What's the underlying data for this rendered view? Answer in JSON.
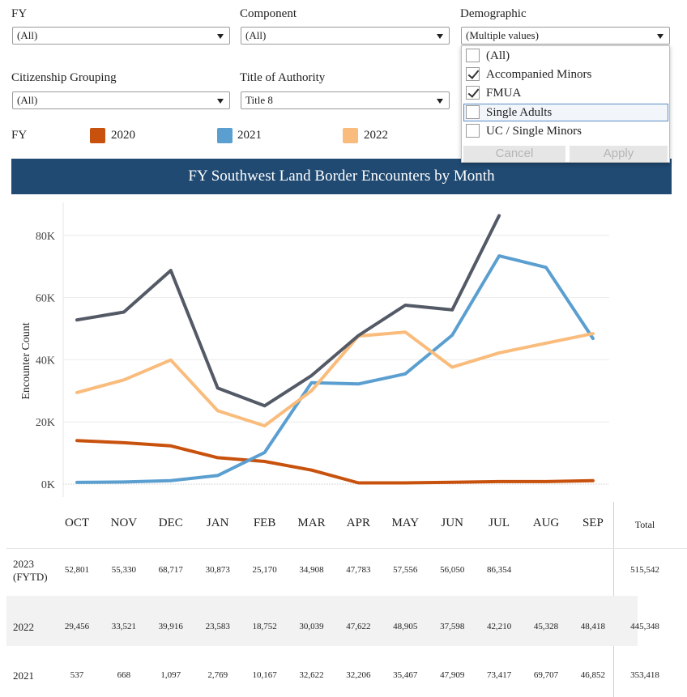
{
  "filters": {
    "fy": {
      "label": "FY",
      "value": "(All)"
    },
    "component": {
      "label": "Component",
      "value": "(All)"
    },
    "demographic": {
      "label": "Demographic",
      "value": "(Multiple values)"
    },
    "citizenship": {
      "label": "Citizenship Grouping",
      "value": "(All)"
    },
    "authority": {
      "label": "Title of Authority",
      "value": "Title 8"
    }
  },
  "demographic_dropdown": {
    "options": [
      {
        "label": "(All)",
        "checked": false
      },
      {
        "label": "Accompanied Minors",
        "checked": true
      },
      {
        "label": "FMUA",
        "checked": true
      },
      {
        "label": "Single Adults",
        "checked": false
      },
      {
        "label": "UC / Single Minors",
        "checked": false
      }
    ],
    "cancel_label": "Cancel",
    "apply_label": "Apply"
  },
  "legend": {
    "title": "FY",
    "items": [
      {
        "label": "2020",
        "color": "#c8520d"
      },
      {
        "label": "2021",
        "color": "#5a9fd0"
      },
      {
        "label": "2022",
        "color": "#f9bc7c"
      }
    ]
  },
  "banner_title": "FY Southwest Land Border Encounters by Month",
  "chart_data": {
    "type": "line",
    "ylabel": "Encounter Count",
    "ylim": [
      0,
      90000
    ],
    "yticks": [
      "0K",
      "20K",
      "40K",
      "60K",
      "80K"
    ],
    "categories": [
      "OCT",
      "NOV",
      "DEC",
      "JAN",
      "FEB",
      "MAR",
      "APR",
      "MAY",
      "JUN",
      "JUL",
      "AUG",
      "SEP"
    ],
    "series": [
      {
        "name": "2020",
        "color": "#c8520d",
        "values": [
          14000,
          13300,
          12300,
          8500,
          7300,
          4500,
          400,
          400,
          600,
          800,
          800,
          1100
        ]
      },
      {
        "name": "2021",
        "color": "#5a9fd0",
        "values": [
          537,
          668,
          1097,
          2769,
          10167,
          32622,
          32206,
          35467,
          47909,
          73417,
          69707,
          46852
        ]
      },
      {
        "name": "2022",
        "color": "#f9bc7c",
        "values": [
          29456,
          33521,
          39916,
          23583,
          18752,
          30039,
          47622,
          48905,
          37598,
          42210,
          45328,
          48418
        ]
      },
      {
        "name": "2023",
        "color": "#535a66",
        "values": [
          52801,
          55330,
          68717,
          30873,
          25170,
          34908,
          47783,
          57556,
          56050,
          86354,
          null,
          null
        ]
      }
    ],
    "grid": true
  },
  "table": {
    "total_header": "Total",
    "rows": [
      {
        "label": "2023 (FYTD)",
        "cells": [
          "52,801",
          "55,330",
          "68,717",
          "30,873",
          "25,170",
          "34,908",
          "47,783",
          "57,556",
          "56,050",
          "86,354",
          "",
          ""
        ],
        "total": "515,542"
      },
      {
        "label": "2022",
        "cells": [
          "29,456",
          "33,521",
          "39,916",
          "23,583",
          "18,752",
          "30,039",
          "47,622",
          "48,905",
          "37,598",
          "42,210",
          "45,328",
          "48,418"
        ],
        "total": "445,348"
      },
      {
        "label": "2021",
        "cells": [
          "537",
          "668",
          "1,097",
          "2,769",
          "10,167",
          "32,622",
          "32,206",
          "35,467",
          "47,909",
          "73,417",
          "69,707",
          "46,852"
        ],
        "total": "353,418"
      }
    ]
  }
}
